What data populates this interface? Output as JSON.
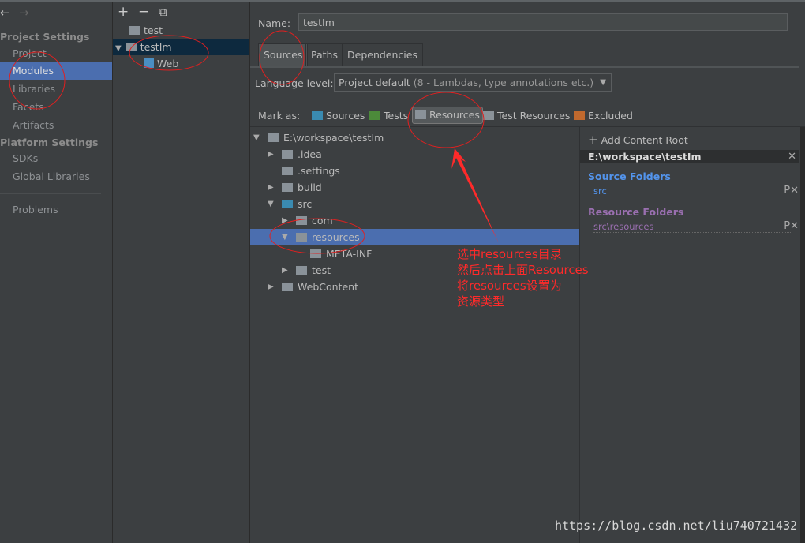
{
  "sidebar": {
    "back": "←",
    "forward": "→",
    "project_settings": "Project Settings",
    "items": [
      "Project",
      "Modules",
      "Libraries",
      "Facets",
      "Artifacts"
    ],
    "platform_settings": "Platform Settings",
    "platform_items": [
      "SDKs",
      "Global Libraries"
    ],
    "problems": "Problems",
    "selected": "Modules"
  },
  "modules": {
    "toolbar": {
      "add": "+",
      "remove": "−",
      "copy": "⧉"
    },
    "items": [
      {
        "label": "test"
      },
      {
        "label": "testIm",
        "selected": true
      },
      {
        "label": "Web"
      }
    ]
  },
  "main": {
    "name_label": "Name:",
    "name_value": "testIm",
    "tabs": [
      "Sources",
      "Paths",
      "Dependencies"
    ],
    "active_tab": "Sources",
    "language_label": "Language level:",
    "language_value": "Project default",
    "language_detail": "(8 - Lambdas, type annotations etc.)",
    "mark_as": "Mark as:",
    "mark_buttons": [
      {
        "label": "Sources",
        "color": "#3a8ab0"
      },
      {
        "label": "Tests",
        "color": "#4c8a3a"
      },
      {
        "label": "Resources",
        "color": "#8a9299"
      },
      {
        "label": "Test Resources",
        "color": "#8a9299"
      },
      {
        "label": "Excluded",
        "color": "#c0692e"
      }
    ],
    "tree": [
      {
        "label": "E:\\workspace\\testIm",
        "depth": 0,
        "arrow": "▼"
      },
      {
        "label": ".idea",
        "depth": 1,
        "arrow": "▶"
      },
      {
        "label": ".settings",
        "depth": 1,
        "arrow": ""
      },
      {
        "label": "build",
        "depth": 1,
        "arrow": "▶"
      },
      {
        "label": "src",
        "depth": 1,
        "arrow": "▼",
        "color": "#3a8ab0"
      },
      {
        "label": "com",
        "depth": 2,
        "arrow": "▶"
      },
      {
        "label": "resources",
        "depth": 2,
        "arrow": "▼",
        "selected": true
      },
      {
        "label": "META-INF",
        "depth": 3,
        "arrow": ""
      },
      {
        "label": "test",
        "depth": 2,
        "arrow": "▶"
      },
      {
        "label": "WebContent",
        "depth": 1,
        "arrow": "▶"
      }
    ],
    "right": {
      "add_root": "Add Content Root",
      "root": "E:\\workspace\\testIm",
      "source_title": "Source Folders",
      "source_items": [
        "src"
      ],
      "resource_title": "Resource Folders",
      "resource_items": [
        "src\\resources"
      ],
      "source_color": "#5394ec",
      "resource_color": "#9a6fb0"
    }
  },
  "annotation": {
    "lines": [
      "选中resources目录",
      "然后点击上面Resources",
      "将resources设置为",
      "资源类型"
    ],
    "color": "#ff2a2a"
  },
  "watermark": "https://blog.csdn.net/liu740721432"
}
